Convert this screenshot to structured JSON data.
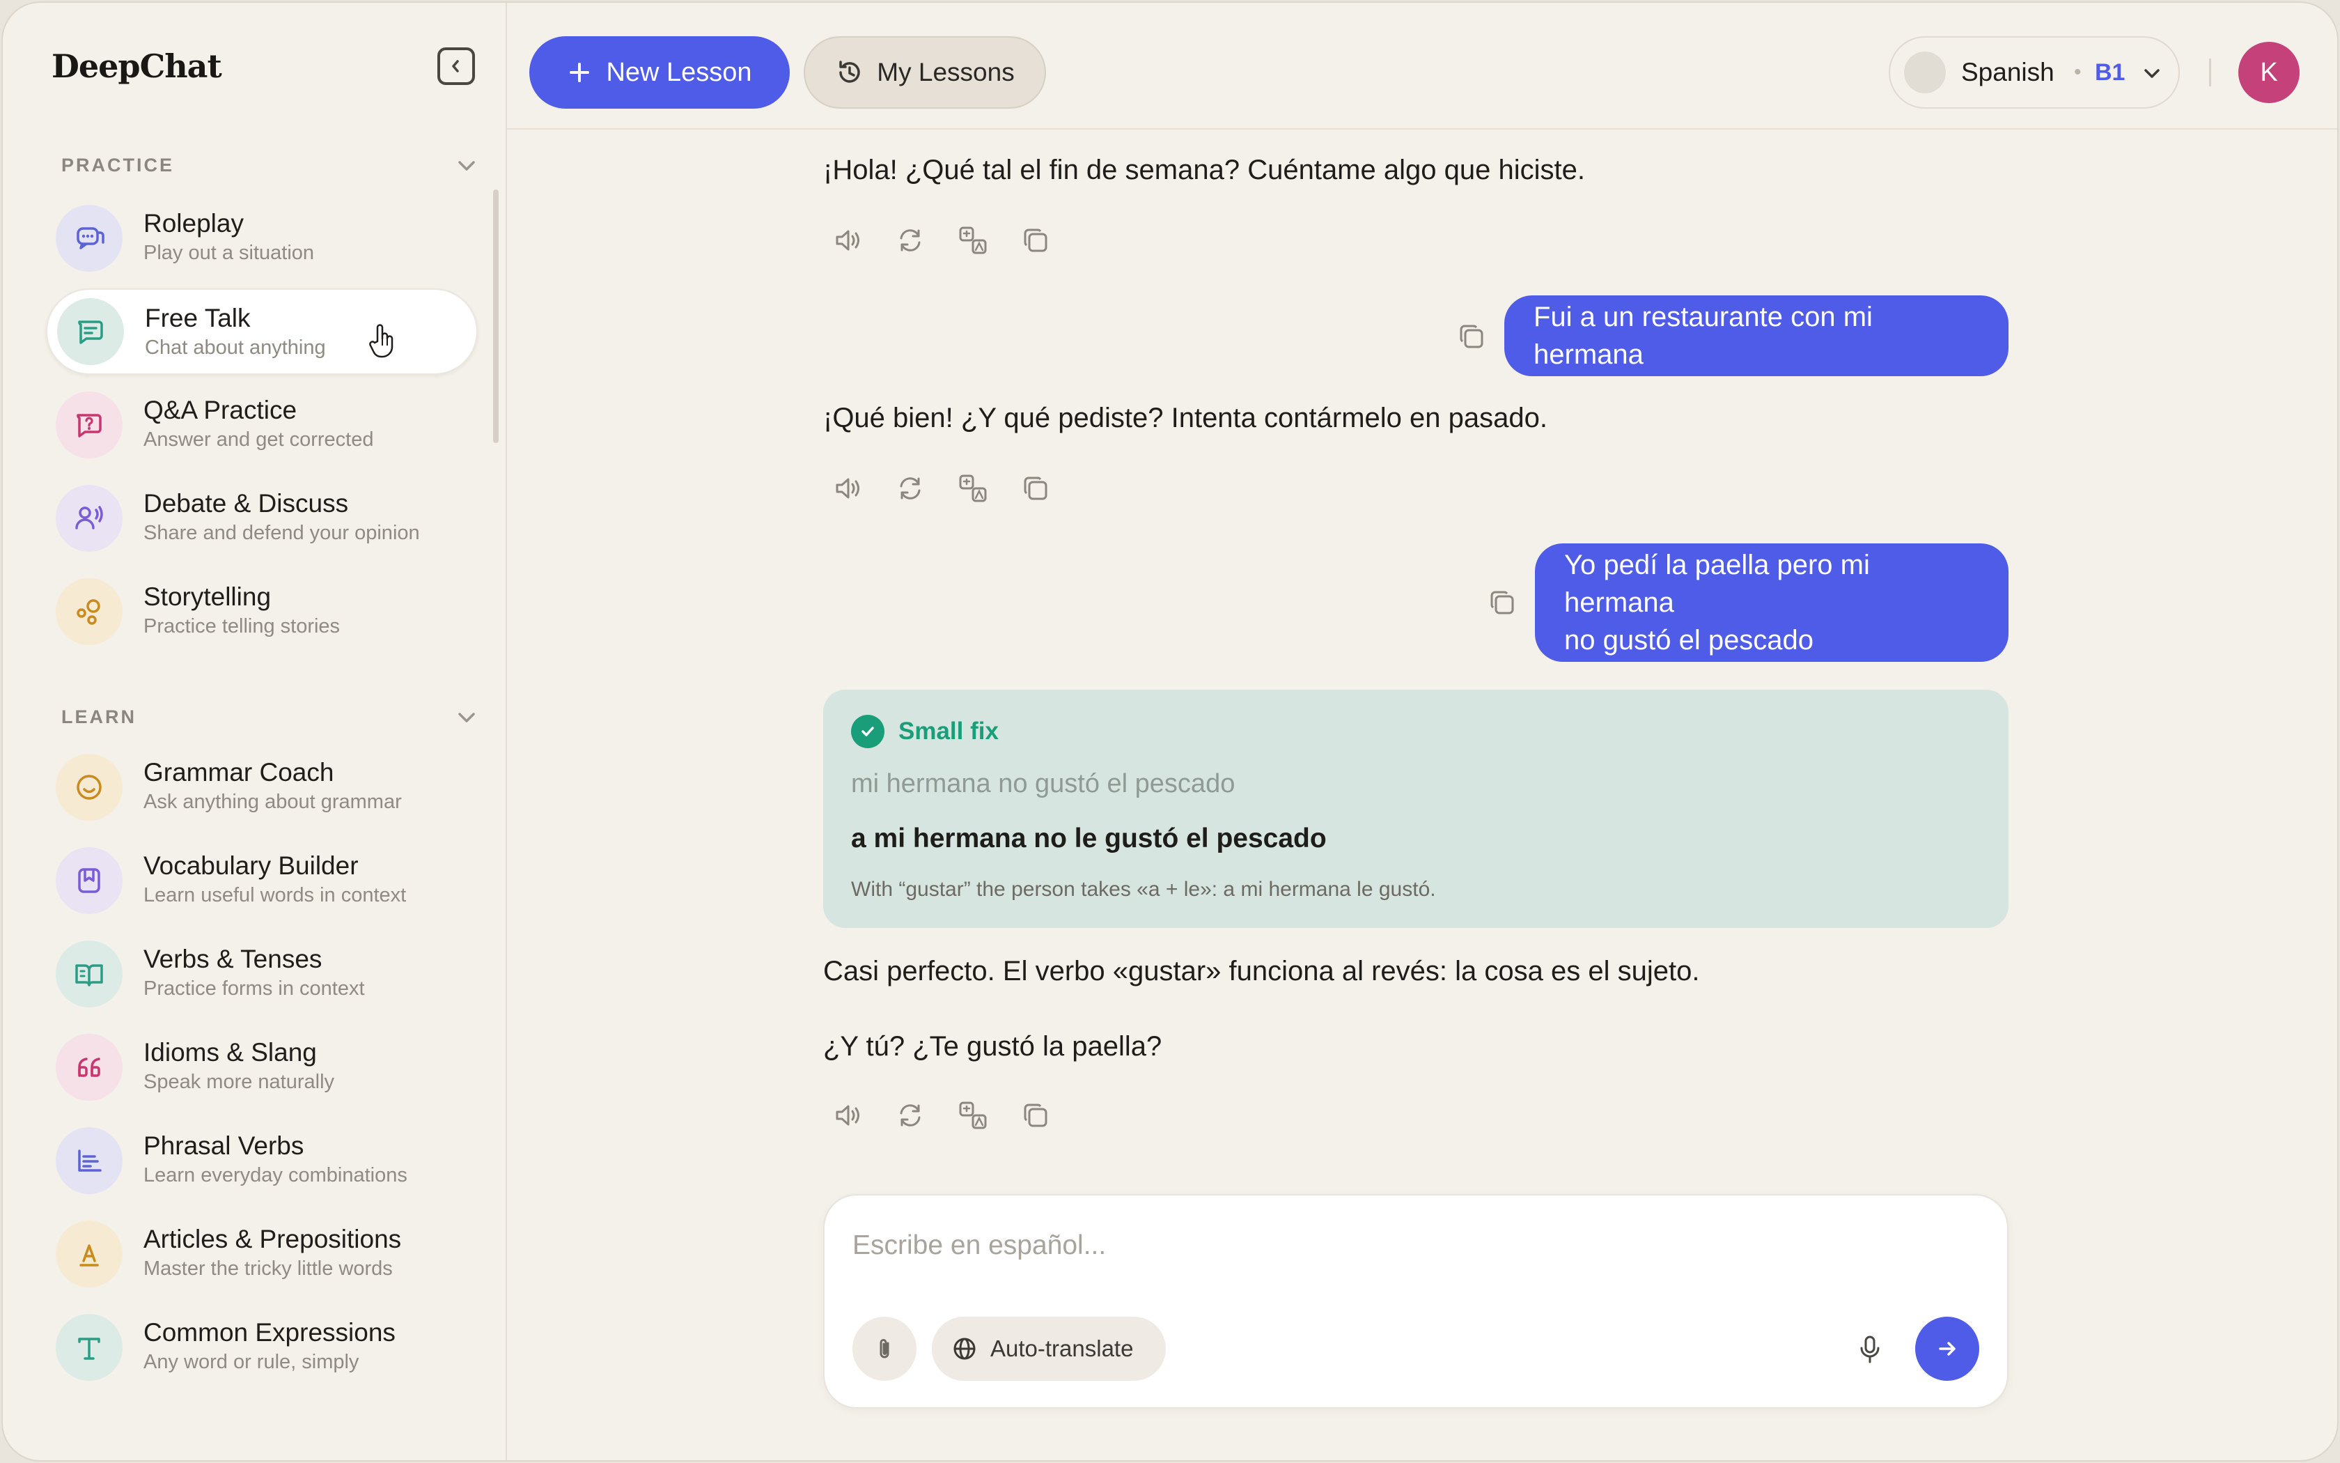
{
  "app": {
    "title": "DeepChat"
  },
  "header": {
    "new_lesson": "New Lesson",
    "my_lessons": "My Lessons",
    "language": "Spanish",
    "separator": "•",
    "level": "B1",
    "avatar_initial": "K"
  },
  "sidebar": {
    "practice_label": "PRACTICE",
    "learn_label": "LEARN",
    "practice": [
      {
        "title": "Roleplay",
        "subtitle": "Play out a situation",
        "icon": "chat-bubbles-icon",
        "color": "#5b63d6",
        "bg": "#e4e3f3"
      },
      {
        "title": "Free Talk",
        "subtitle": "Chat about anything",
        "icon": "message-icon",
        "color": "#2a9d84",
        "bg": "#dcebe5",
        "active": true
      },
      {
        "title": "Q&A Practice",
        "subtitle": "Answer and get corrected",
        "icon": "question-bubble-icon",
        "color": "#c9356e",
        "bg": "#f6e1e8"
      },
      {
        "title": "Debate & Discuss",
        "subtitle": "Share and defend your opinion",
        "icon": "speaker-person-icon",
        "color": "#7a5cd6",
        "bg": "#e9e3f4"
      },
      {
        "title": "Storytelling",
        "subtitle": "Practice telling stories",
        "icon": "circles-icon",
        "color": "#c98a1e",
        "bg": "#f7ead3"
      }
    ],
    "learn": [
      {
        "title": "Grammar Coach",
        "subtitle": "Ask anything about grammar",
        "icon": "smile-icon",
        "color": "#c98a1e",
        "bg": "#f7ead3"
      },
      {
        "title": "Vocabulary Builder",
        "subtitle": "Learn useful words in context",
        "icon": "bookmark-icon",
        "color": "#7a5cd6",
        "bg": "#e9e3f4"
      },
      {
        "title": "Verbs & Tenses",
        "subtitle": "Practice forms in context",
        "icon": "book-open-icon",
        "color": "#2a9d84",
        "bg": "#dcebe5"
      },
      {
        "title": "Idioms & Slang",
        "subtitle": "Speak more naturally",
        "icon": "quote-icon",
        "color": "#c9356e",
        "bg": "#f6e1e8"
      },
      {
        "title": "Phrasal Verbs",
        "subtitle": "Learn everyday combinations",
        "icon": "lines-icon",
        "color": "#5b63d6",
        "bg": "#e4e3f3"
      },
      {
        "title": "Articles & Prepositions",
        "subtitle": "Master the tricky little words",
        "icon": "letter-a-icon",
        "color": "#c98a1e",
        "bg": "#f7ead3"
      },
      {
        "title": "Common Expressions",
        "subtitle": "Any word or rule, simply",
        "icon": "letter-t-icon",
        "color": "#2a9d84",
        "bg": "#dcebe5"
      }
    ]
  },
  "chat": {
    "ai_1": "¡Hola! ¿Qué tal el fin de semana? Cuéntame algo que hiciste.",
    "user_1": "Fui a un restaurante con mi hermana",
    "ai_2": "¡Qué bien! ¿Y qué pediste? Intenta contármelo en pasado.",
    "user_2_line1": "Yo pedí la paella pero mi hermana",
    "user_2_line2": "no gustó el pescado",
    "fix_title": "Small fix",
    "fix_wrong": "mi hermana no gustó el pescado",
    "fix_right": "a mi hermana no le gustó el pescado",
    "fix_note": "With “gustar” the person takes «a + le»: a mi hermana le gustó.",
    "ai_3a": "Casi perfecto. El verbo «gustar» funciona al revés: la cosa es el sujeto.",
    "ai_3b": "¿Y tú? ¿Te gustó la paella?"
  },
  "composer": {
    "placeholder": "Escribe en español...",
    "auto_translate": "Auto-translate"
  },
  "colors": {
    "accent": "#4f5ce8",
    "success": "#1a9e7a",
    "avatar": "#c4417a"
  }
}
